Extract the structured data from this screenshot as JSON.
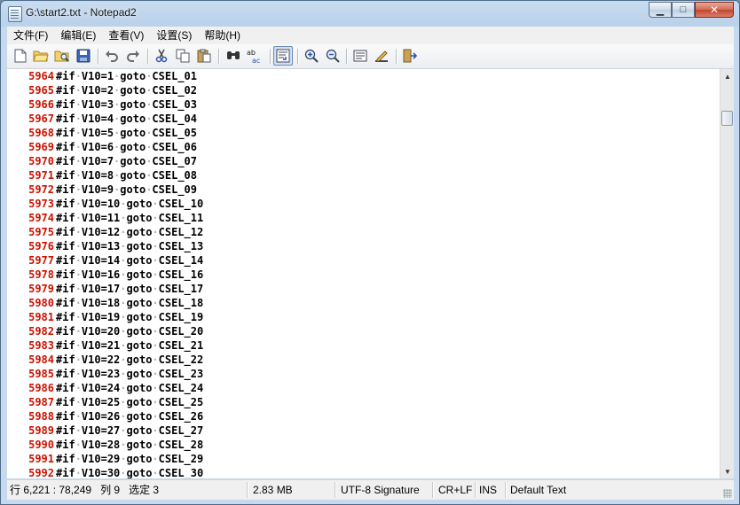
{
  "window": {
    "title": "G:\\start2.txt - Notepad2"
  },
  "caption_buttons": {
    "minimize": "▁",
    "maximize": "□",
    "close": "✕"
  },
  "menu": [
    "文件(F)",
    "编辑(E)",
    "查看(V)",
    "设置(S)",
    "帮助(H)"
  ],
  "editor": {
    "lines": [
      {
        "n": "5964",
        "text": "#if·V10=1·goto·CSEL_01"
      },
      {
        "n": "5965",
        "text": "#if·V10=2·goto·CSEL_02"
      },
      {
        "n": "5966",
        "text": "#if·V10=3·goto·CSEL_03"
      },
      {
        "n": "5967",
        "text": "#if·V10=4·goto·CSEL_04"
      },
      {
        "n": "5968",
        "text": "#if·V10=5·goto·CSEL_05"
      },
      {
        "n": "5969",
        "text": "#if·V10=6·goto·CSEL_06"
      },
      {
        "n": "5970",
        "text": "#if·V10=7·goto·CSEL_07"
      },
      {
        "n": "5971",
        "text": "#if·V10=8·goto·CSEL_08"
      },
      {
        "n": "5972",
        "text": "#if·V10=9·goto·CSEL_09"
      },
      {
        "n": "5973",
        "text": "#if·V10=10·goto·CSEL_10"
      },
      {
        "n": "5974",
        "text": "#if·V10=11·goto·CSEL_11"
      },
      {
        "n": "5975",
        "text": "#if·V10=12·goto·CSEL_12"
      },
      {
        "n": "5976",
        "text": "#if·V10=13·goto·CSEL_13"
      },
      {
        "n": "5977",
        "text": "#if·V10=14·goto·CSEL_14"
      },
      {
        "n": "5978",
        "text": "#if·V10=16·goto·CSEL_16"
      },
      {
        "n": "5979",
        "text": "#if·V10=17·goto·CSEL_17"
      },
      {
        "n": "5980",
        "text": "#if·V10=18·goto·CSEL_18"
      },
      {
        "n": "5981",
        "text": "#if·V10=19·goto·CSEL_19"
      },
      {
        "n": "5982",
        "text": "#if·V10=20·goto·CSEL_20"
      },
      {
        "n": "5983",
        "text": "#if·V10=21·goto·CSEL_21"
      },
      {
        "n": "5984",
        "text": "#if·V10=22·goto·CSEL_22"
      },
      {
        "n": "5985",
        "text": "#if·V10=23·goto·CSEL_23"
      },
      {
        "n": "5986",
        "text": "#if·V10=24·goto·CSEL_24"
      },
      {
        "n": "5987",
        "text": "#if·V10=25·goto·CSEL_25"
      },
      {
        "n": "5988",
        "text": "#if·V10=26·goto·CSEL_26"
      },
      {
        "n": "5989",
        "text": "#if·V10=27·goto·CSEL_27"
      },
      {
        "n": "5990",
        "text": "#if·V10=28·goto·CSEL_28"
      },
      {
        "n": "5991",
        "text": "#if·V10=29·goto·CSEL_29"
      },
      {
        "n": "5992",
        "text": "#if·V10=30·goto·CSEL_30"
      }
    ]
  },
  "status": {
    "position": "行 6,221 : 78,249   列 9   选定 3",
    "size": "2.83 MB",
    "encoding": "UTF-8 Signature",
    "eol": "CR+LF",
    "mode": "INS",
    "scheme": "Default Text"
  },
  "colors": {
    "line_number": "#cc1100",
    "whitespace_dot": "#b0b0b0",
    "accent": "#cfe0f5"
  },
  "toolbar_icons": [
    "new-file-icon",
    "open-file-icon",
    "browse-icon",
    "save-icon",
    "undo-icon",
    "redo-icon",
    "cut-icon",
    "copy-icon",
    "paste-icon",
    "find-icon",
    "replace-icon",
    "word-wrap-icon",
    "zoom-in-icon",
    "zoom-out-icon",
    "view-scheme-icon",
    "customize-scheme-icon",
    "exit-icon"
  ]
}
